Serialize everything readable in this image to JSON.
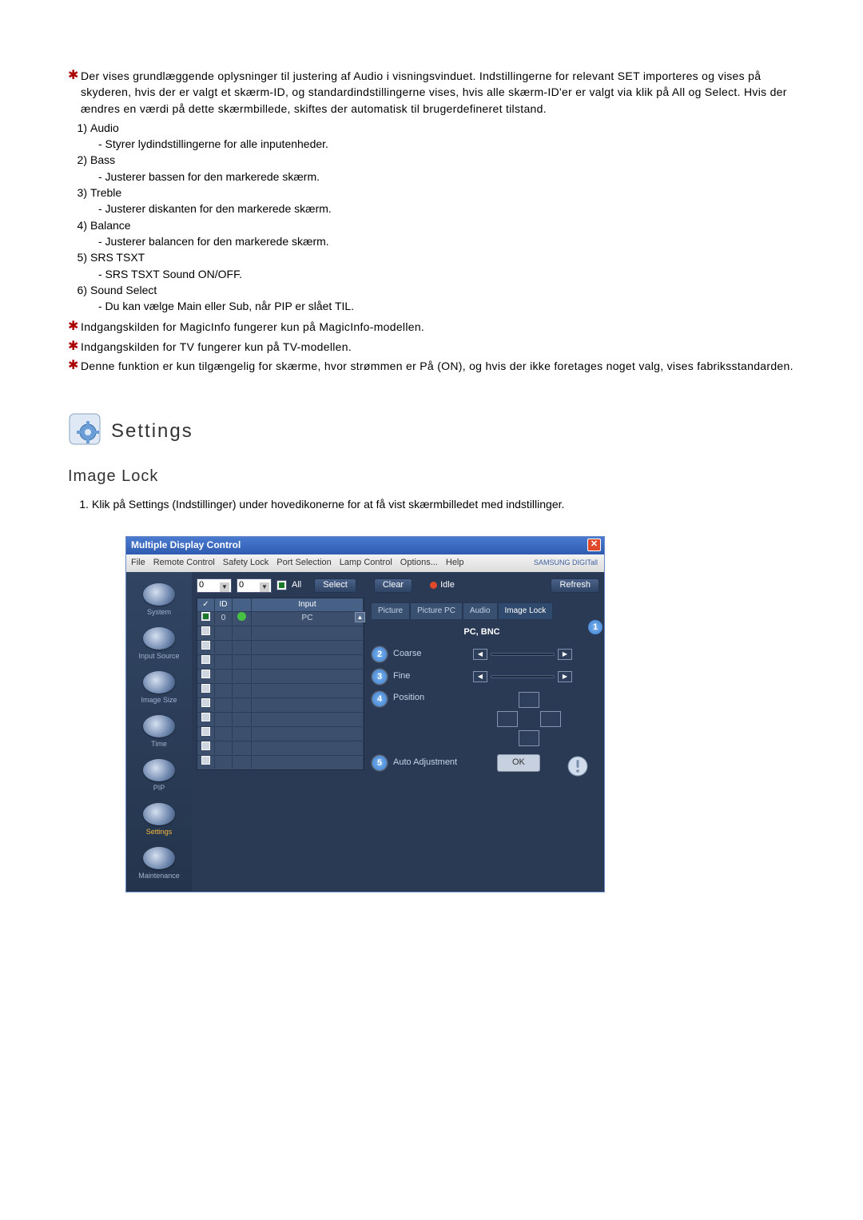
{
  "notes": {
    "intro": "Der vises grundlæggende oplysninger til justering af Audio i visningsvinduet. Indstillingerne for relevant SET importeres og vises på skyderen, hvis der er valgt et skærm-ID, og standardindstillingerne vises, hvis alle skærm-ID'er er valgt via klik på All og Select. Hvis der ændres en værdi på dette skærmbillede, skiftes der automatisk til brugerdefineret tilstand.",
    "items": [
      {
        "idx": "1)",
        "title": "Audio",
        "desc": "- Styrer lydindstillingerne for alle inputenheder."
      },
      {
        "idx": "2)",
        "title": "Bass",
        "desc": "- Justerer bassen for den markerede skærm."
      },
      {
        "idx": "3)",
        "title": "Treble",
        "desc": "- Justerer diskanten for den markerede skærm."
      },
      {
        "idx": "4)",
        "title": "Balance",
        "desc": "- Justerer balancen for den markerede skærm."
      },
      {
        "idx": "5)",
        "title": "SRS TSXT",
        "desc": "- SRS TSXT Sound ON/OFF."
      },
      {
        "idx": "6)",
        "title": "Sound Select",
        "desc": "- Du kan vælge Main eller Sub, når PIP er slået TIL."
      }
    ],
    "footnotes": [
      "Indgangskilden for MagicInfo fungerer kun på MagicInfo-modellen.",
      "Indgangskilden for TV fungerer kun på TV-modellen.",
      "Denne funktion er kun tilgængelig for skærme, hvor strømmen er På (ON), og hvis der ikke foretages noget valg, vises fabriksstandarden."
    ]
  },
  "section": {
    "title": "Settings",
    "subheading": "Image Lock",
    "step_idx": "1.",
    "step_text": "Klik på Settings (Indstillinger) under hovedikonerne for at få vist skærmbilledet med indstillinger."
  },
  "shot": {
    "title": "Multiple Display Control",
    "menu": [
      "File",
      "Remote Control",
      "Safety Lock",
      "Port Selection",
      "Lamp Control",
      "Options...",
      "Help"
    ],
    "brand": "SAMSUNG DIGITall",
    "sidebar": [
      "System",
      "Input Source",
      "Image Size",
      "Time",
      "PIP",
      "Settings",
      "Maintenance"
    ],
    "active_sidebar": "Settings",
    "dropdown1": "0",
    "dropdown2": "0",
    "all_label": "All",
    "btn_select": "Select",
    "btn_clear": "Clear",
    "idle_label": "Idle",
    "btn_refresh": "Refresh",
    "cols": {
      "c1": "✓",
      "c2": "ID",
      "c3": " ",
      "c4": "Input"
    },
    "row1": {
      "id": "0",
      "input": "PC"
    },
    "right_tabs": [
      "Picture",
      "Picture PC",
      "Audio",
      "Image Lock"
    ],
    "right_active": "Image Lock",
    "panel_title": "PC, BNC",
    "params": {
      "p2": "Coarse",
      "p3": "Fine",
      "p4": "Position",
      "p5": "Auto Adjustment"
    },
    "ok": "OK",
    "marker1": "1",
    "markers": {
      "m2": "2",
      "m3": "3",
      "m4": "4",
      "m5": "5"
    }
  }
}
